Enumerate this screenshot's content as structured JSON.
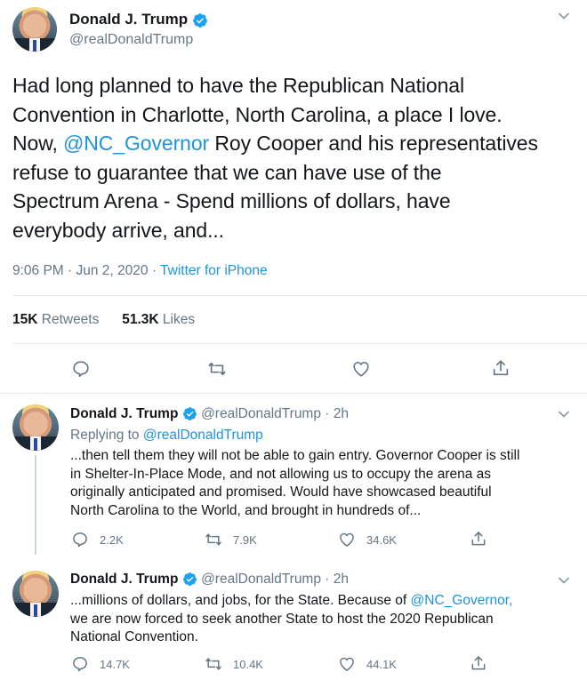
{
  "main_tweet": {
    "author_name": "Donald J. Trump",
    "author_handle": "@realDonaldTrump",
    "text_line1": "Had long planned to have the Republican National",
    "text_line2": "Convention in Charlotte, North Carolina, a place I love.",
    "text_line3_prefix": "Now,",
    "text_line3_mention": "@NC_Governor",
    "text_line3_suffix": "Roy Cooper and his representatives",
    "text_line4": "refuse to guarantee that we can have use of the",
    "text_line5": "Spectrum Arena - Spend millions of dollars, have",
    "text_line6": "everybody arrive, and...",
    "time": "9:06 PM · Jun 2, 2020 ·",
    "source": "Twitter for iPhone",
    "retweets_count": "15K",
    "retweets_label": "Retweets",
    "likes_count": "51.3K",
    "likes_label": "Likes"
  },
  "replies": [
    {
      "author_name": "Donald J. Trump",
      "author_handle": "@realDonaldTrump · 2h",
      "replying_to_label": "Replying to",
      "replying_to_handle": "@realDonaldTrump",
      "line1": "...then tell them they will not be able to gain entry. Governor Cooper is still",
      "line2": "in Shelter-In-Place Mode, and not allowing us to occupy the arena as",
      "line3": "originally anticipated and promised. Would have showcased beautiful",
      "line4": "North Carolina to the World, and brought in hundreds of...",
      "replies_count": "2.2K",
      "retweets_count": "7.9K",
      "likes_count": "34.6K"
    },
    {
      "author_name": "Donald J. Trump",
      "author_handle": "@realDonaldTrump · 2h",
      "line1_prefix": "...millions of dollars, and jobs, for the State. Because of",
      "line1_mention": "@NC_Governor,",
      "line2": "we are now forced to seek another State to host the 2020 Republican",
      "line3": "National Convention.",
      "replies_count": "14.7K",
      "retweets_count": "10.4K",
      "likes_count": "44.1K"
    }
  ],
  "icons": {
    "verified": "verified-badge-icon",
    "reply": "reply-bubble-icon",
    "retweet": "retweet-icon",
    "like": "heart-icon",
    "share": "share-icon",
    "more": "chevron-down-icon"
  },
  "colors": {
    "link": "#1b95e0",
    "verified": "#1da1f2",
    "secondary_text": "#657786",
    "icon": "#657786"
  }
}
